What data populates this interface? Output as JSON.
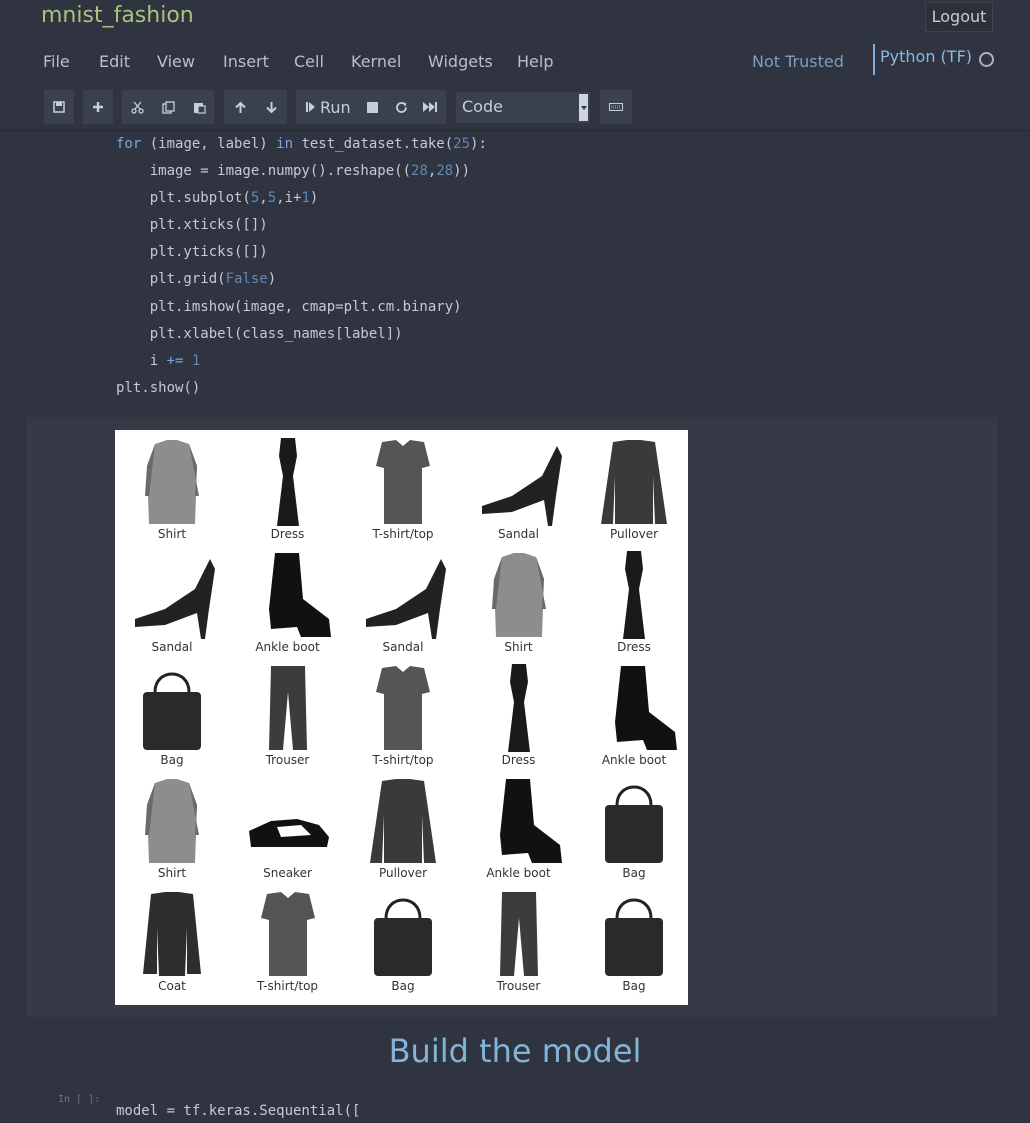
{
  "header": {
    "notebook_title": "mnist_fashion",
    "logout_label": "Logout",
    "trust_status": "Not Trusted",
    "kernel_name": "Python (TF)"
  },
  "menu": [
    "File",
    "Edit",
    "View",
    "Insert",
    "Cell",
    "Kernel",
    "Widgets",
    "Help"
  ],
  "toolbar": {
    "run_label": "Run",
    "cell_type": "Code",
    "icons": [
      "save-icon",
      "add-cell-icon",
      "cut-icon",
      "copy-icon",
      "paste-icon",
      "move-up-icon",
      "move-down-icon",
      "run-icon",
      "stop-icon",
      "restart-icon",
      "fast-forward-icon",
      "keyboard-icon"
    ]
  },
  "code_cell": {
    "lines": [
      "for (image, label) in test_dataset.take(25):",
      "    image = image.numpy().reshape((28,28))",
      "    plt.subplot(5,5,i+1)",
      "    plt.xticks([])",
      "    plt.yticks([])",
      "    plt.grid(False)",
      "    plt.imshow(image, cmap=plt.cm.binary)",
      "    plt.xlabel(class_names[label])",
      "    i += 1",
      "plt.show()"
    ]
  },
  "output_figure": {
    "labels": [
      "Shirt",
      "Dress",
      "T-shirt/top",
      "Sandal",
      "Pullover",
      "Sandal",
      "Ankle boot",
      "Sandal",
      "Shirt",
      "Dress",
      "Bag",
      "Trouser",
      "T-shirt/top",
      "Dress",
      "Ankle boot",
      "Shirt",
      "Sneaker",
      "Pullover",
      "Ankle boot",
      "Bag",
      "Coat",
      "T-shirt/top",
      "Bag",
      "Trouser",
      "Bag"
    ]
  },
  "markdown": {
    "heading": "Build the model"
  },
  "next_cell": {
    "prompt": "In [ ]:",
    "first_line": "model = tf.keras.Sequential(["
  },
  "colors": {
    "background": "#2f3440",
    "title": "#a8c37e",
    "heading": "#82b4d8",
    "keyword": "#7aa6da"
  }
}
